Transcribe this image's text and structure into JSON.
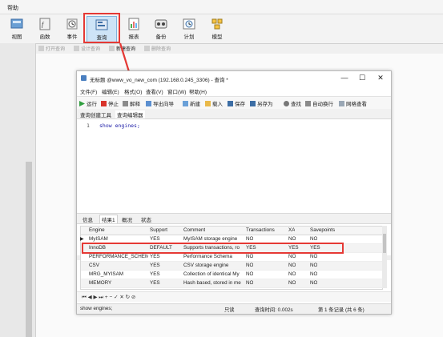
{
  "menubar": {
    "help": "帮助"
  },
  "toolbar": {
    "items": [
      {
        "label": "视图",
        "icon": "view-icon"
      },
      {
        "label": "函数",
        "icon": "function-icon"
      },
      {
        "label": "事件",
        "icon": "event-clock-icon"
      },
      {
        "label": "查询",
        "icon": "query-icon"
      },
      {
        "label": "报表",
        "icon": "report-icon"
      },
      {
        "label": "备份",
        "icon": "backup-icon"
      },
      {
        "label": "计划",
        "icon": "schedule-icon"
      },
      {
        "label": "模型",
        "icon": "model-icon"
      }
    ]
  },
  "subtoolbar": {
    "open": "打开查询",
    "design": "设计查询",
    "new": "新建查询",
    "delete": "删除查询"
  },
  "window": {
    "title": "无标题 @www_vo_new_com (192.168.0.245_3306) - 查询 *",
    "minimize": "—",
    "maximize": "☐",
    "close": "✕",
    "menu": [
      "文件(F)",
      "编辑(E)",
      "格式(O)",
      "查看(V)",
      "窗口(W)",
      "帮助(H)"
    ],
    "toolbar": {
      "run": "运行",
      "stop": "停止",
      "explain": "解释",
      "export": "导出向导",
      "new": "新建",
      "load": "载入",
      "save": "保存",
      "saveas": "另存为",
      "find": "查找",
      "autowrap": "自动换行",
      "gridview": "网格查看"
    },
    "tabs": {
      "builder": "查询创建工具",
      "editor": "查询编辑器"
    },
    "editor": {
      "line": "1",
      "code": "show engines;"
    },
    "result_tabs": {
      "info": "信息",
      "result": "结果1",
      "overview": "概况",
      "status": "状态"
    },
    "table": {
      "columns": [
        "Engine",
        "Support",
        "Comment",
        "Transactions",
        "XA",
        "Savepoints"
      ],
      "rows": [
        [
          "MyISAM",
          "YES",
          "MyISAM storage engine",
          "NO",
          "NO",
          "NO"
        ],
        [
          "InnoDB",
          "DEFAULT",
          "Supports transactions, ro",
          "YES",
          "YES",
          "YES"
        ],
        [
          "PERFORMANCE_SCHEMA",
          "YES",
          "Performance Schema",
          "NO",
          "NO",
          "NO"
        ],
        [
          "CSV",
          "YES",
          "CSV storage engine",
          "NO",
          "NO",
          "NO"
        ],
        [
          "MRG_MYISAM",
          "YES",
          "Collection of identical My",
          "NO",
          "NO",
          "NO"
        ],
        [
          "MEMORY",
          "YES",
          "Hash based, stored in me",
          "NO",
          "NO",
          "NO"
        ]
      ]
    },
    "nav": "⏮ ◀ ▶ ⏭ + − ✓ ✕ ↻ ⊘",
    "status": {
      "query": "show engines;",
      "readonly": "只读",
      "time": "查询时间: 0.002s",
      "records": "第 1 条记录 (共 6 条)"
    }
  },
  "colors": {
    "highlight": "#e53935",
    "run": "#2e9e3e",
    "stop": "#d9342b"
  }
}
